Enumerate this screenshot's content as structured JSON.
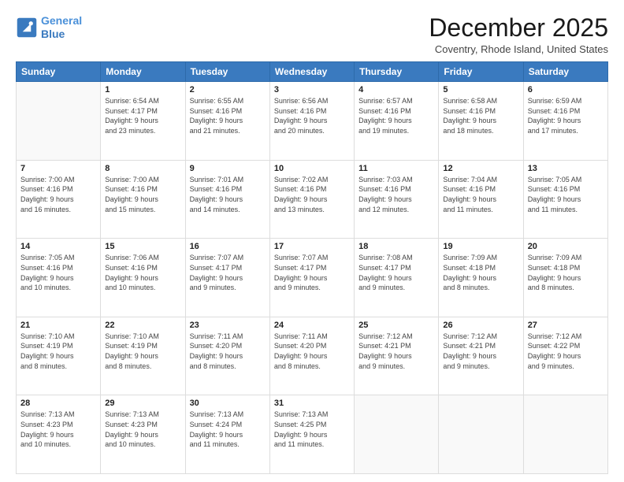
{
  "header": {
    "logo_line1": "General",
    "logo_line2": "Blue",
    "title": "December 2025",
    "subtitle": "Coventry, Rhode Island, United States"
  },
  "calendar": {
    "days_of_week": [
      "Sunday",
      "Monday",
      "Tuesday",
      "Wednesday",
      "Thursday",
      "Friday",
      "Saturday"
    ],
    "rows": [
      [
        {
          "num": "",
          "info": ""
        },
        {
          "num": "1",
          "info": "Sunrise: 6:54 AM\nSunset: 4:17 PM\nDaylight: 9 hours\nand 23 minutes."
        },
        {
          "num": "2",
          "info": "Sunrise: 6:55 AM\nSunset: 4:16 PM\nDaylight: 9 hours\nand 21 minutes."
        },
        {
          "num": "3",
          "info": "Sunrise: 6:56 AM\nSunset: 4:16 PM\nDaylight: 9 hours\nand 20 minutes."
        },
        {
          "num": "4",
          "info": "Sunrise: 6:57 AM\nSunset: 4:16 PM\nDaylight: 9 hours\nand 19 minutes."
        },
        {
          "num": "5",
          "info": "Sunrise: 6:58 AM\nSunset: 4:16 PM\nDaylight: 9 hours\nand 18 minutes."
        },
        {
          "num": "6",
          "info": "Sunrise: 6:59 AM\nSunset: 4:16 PM\nDaylight: 9 hours\nand 17 minutes."
        }
      ],
      [
        {
          "num": "7",
          "info": "Sunrise: 7:00 AM\nSunset: 4:16 PM\nDaylight: 9 hours\nand 16 minutes."
        },
        {
          "num": "8",
          "info": "Sunrise: 7:00 AM\nSunset: 4:16 PM\nDaylight: 9 hours\nand 15 minutes."
        },
        {
          "num": "9",
          "info": "Sunrise: 7:01 AM\nSunset: 4:16 PM\nDaylight: 9 hours\nand 14 minutes."
        },
        {
          "num": "10",
          "info": "Sunrise: 7:02 AM\nSunset: 4:16 PM\nDaylight: 9 hours\nand 13 minutes."
        },
        {
          "num": "11",
          "info": "Sunrise: 7:03 AM\nSunset: 4:16 PM\nDaylight: 9 hours\nand 12 minutes."
        },
        {
          "num": "12",
          "info": "Sunrise: 7:04 AM\nSunset: 4:16 PM\nDaylight: 9 hours\nand 11 minutes."
        },
        {
          "num": "13",
          "info": "Sunrise: 7:05 AM\nSunset: 4:16 PM\nDaylight: 9 hours\nand 11 minutes."
        }
      ],
      [
        {
          "num": "14",
          "info": "Sunrise: 7:05 AM\nSunset: 4:16 PM\nDaylight: 9 hours\nand 10 minutes."
        },
        {
          "num": "15",
          "info": "Sunrise: 7:06 AM\nSunset: 4:16 PM\nDaylight: 9 hours\nand 10 minutes."
        },
        {
          "num": "16",
          "info": "Sunrise: 7:07 AM\nSunset: 4:17 PM\nDaylight: 9 hours\nand 9 minutes."
        },
        {
          "num": "17",
          "info": "Sunrise: 7:07 AM\nSunset: 4:17 PM\nDaylight: 9 hours\nand 9 minutes."
        },
        {
          "num": "18",
          "info": "Sunrise: 7:08 AM\nSunset: 4:17 PM\nDaylight: 9 hours\nand 9 minutes."
        },
        {
          "num": "19",
          "info": "Sunrise: 7:09 AM\nSunset: 4:18 PM\nDaylight: 9 hours\nand 8 minutes."
        },
        {
          "num": "20",
          "info": "Sunrise: 7:09 AM\nSunset: 4:18 PM\nDaylight: 9 hours\nand 8 minutes."
        }
      ],
      [
        {
          "num": "21",
          "info": "Sunrise: 7:10 AM\nSunset: 4:19 PM\nDaylight: 9 hours\nand 8 minutes."
        },
        {
          "num": "22",
          "info": "Sunrise: 7:10 AM\nSunset: 4:19 PM\nDaylight: 9 hours\nand 8 minutes."
        },
        {
          "num": "23",
          "info": "Sunrise: 7:11 AM\nSunset: 4:20 PM\nDaylight: 9 hours\nand 8 minutes."
        },
        {
          "num": "24",
          "info": "Sunrise: 7:11 AM\nSunset: 4:20 PM\nDaylight: 9 hours\nand 8 minutes."
        },
        {
          "num": "25",
          "info": "Sunrise: 7:12 AM\nSunset: 4:21 PM\nDaylight: 9 hours\nand 9 minutes."
        },
        {
          "num": "26",
          "info": "Sunrise: 7:12 AM\nSunset: 4:21 PM\nDaylight: 9 hours\nand 9 minutes."
        },
        {
          "num": "27",
          "info": "Sunrise: 7:12 AM\nSunset: 4:22 PM\nDaylight: 9 hours\nand 9 minutes."
        }
      ],
      [
        {
          "num": "28",
          "info": "Sunrise: 7:13 AM\nSunset: 4:23 PM\nDaylight: 9 hours\nand 10 minutes."
        },
        {
          "num": "29",
          "info": "Sunrise: 7:13 AM\nSunset: 4:23 PM\nDaylight: 9 hours\nand 10 minutes."
        },
        {
          "num": "30",
          "info": "Sunrise: 7:13 AM\nSunset: 4:24 PM\nDaylight: 9 hours\nand 11 minutes."
        },
        {
          "num": "31",
          "info": "Sunrise: 7:13 AM\nSunset: 4:25 PM\nDaylight: 9 hours\nand 11 minutes."
        },
        {
          "num": "",
          "info": ""
        },
        {
          "num": "",
          "info": ""
        },
        {
          "num": "",
          "info": ""
        }
      ]
    ]
  }
}
